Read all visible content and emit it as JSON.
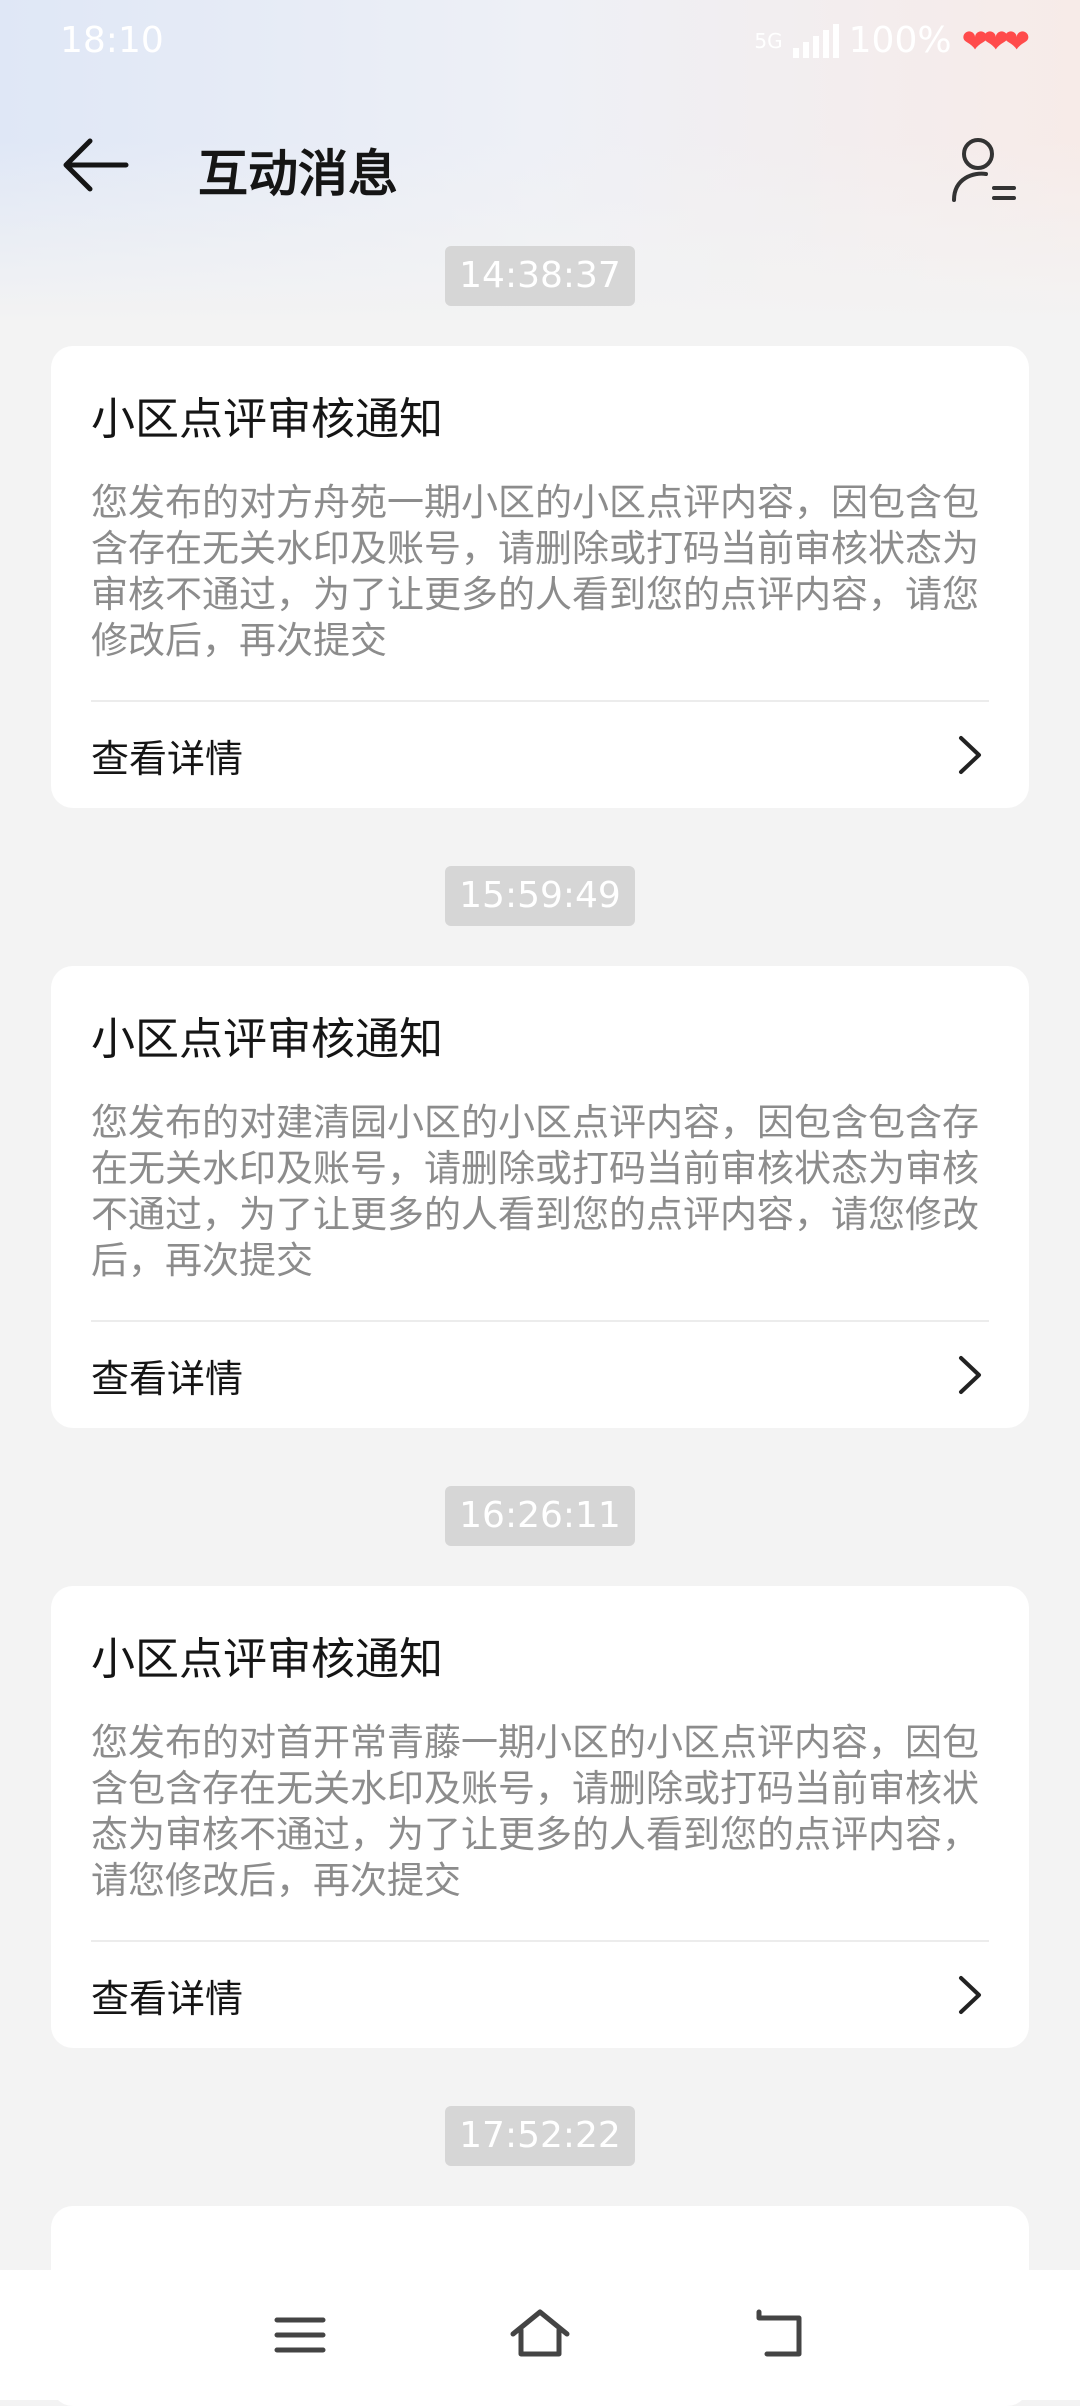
{
  "status_bar": {
    "time": "18:10",
    "network": "5G",
    "battery": "100%"
  },
  "header": {
    "title": "互动消息"
  },
  "messages": [
    {
      "time": "14:38:37",
      "title": "小区点评审核通知",
      "body": "您发布的对方舟苑一期小区的小区点评内容，因包含包含存在无关水印及账号，请删除或打码当前审核状态为审核不通过，为了让更多的人看到您的点评内容，请您修改后，再次提交",
      "action": "查看详情"
    },
    {
      "time": "15:59:49",
      "title": "小区点评审核通知",
      "body": "您发布的对建清园小区的小区点评内容，因包含包含存在无关水印及账号，请删除或打码当前审核状态为审核不通过，为了让更多的人看到您的点评内容，请您修改后，再次提交",
      "action": "查看详情"
    },
    {
      "time": "16:26:11",
      "title": "小区点评审核通知",
      "body": "您发布的对首开常青藤一期小区的小区点评内容，因包含包含存在无关水印及账号，请删除或打码当前审核状态为审核不通过，为了让更多的人看到您的点评内容，请您修改后，再次提交",
      "action": "查看详情"
    },
    {
      "time": "17:52:22"
    }
  ],
  "colors": {
    "card_bg": "#ffffff",
    "page_bg": "#f3f3f3",
    "time_chip": "#d6d6d6",
    "body_text": "#8c8c8c",
    "title_text": "#151515"
  },
  "icons": [
    "back-arrow-icon",
    "user-settings-icon",
    "chevron-right-icon",
    "menu-icon",
    "home-icon",
    "back-icon"
  ]
}
